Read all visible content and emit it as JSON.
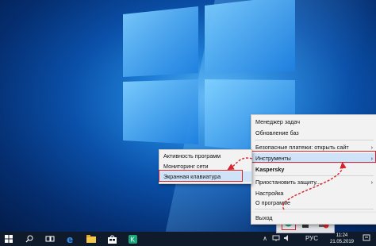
{
  "desktop": {
    "background_colors": [
      "#5ab4f2",
      "#0a4fa8",
      "#031c4a"
    ]
  },
  "taskbar": {
    "icons": [
      "windows-start-icon",
      "search-icon",
      "task-view-icon",
      "edge-browser-icon",
      "file-explorer-icon",
      "store-icon",
      "kaspersky-taskbar-icon"
    ],
    "language": "РУС",
    "time": "11:24",
    "date": "21.05.2019"
  },
  "main_menu": {
    "items": [
      {
        "label": "Менеджер задач"
      },
      {
        "label": "Обновление баз"
      },
      {
        "label": "Безопасные платежи: открыть сайт",
        "submenu": true
      },
      {
        "label": "Инструменты",
        "submenu": true
      },
      {
        "label": "Kaspersky",
        "bold": true
      },
      {
        "label": "Приостановить защиту...",
        "submenu": true
      },
      {
        "label": "Настройка"
      },
      {
        "label": "О программе"
      },
      {
        "label": "Выход"
      }
    ],
    "arrow_glyph": "›"
  },
  "tools_submenu": {
    "items": [
      {
        "label": "Активность программ"
      },
      {
        "label": "Мониторинг сети"
      },
      {
        "label": "Экранная клавиатура"
      }
    ]
  },
  "accent": {
    "highlight_red": "#d9232a",
    "menu_hover": "#cfe3f8",
    "taskbar_bg": "#0f1a2a"
  }
}
